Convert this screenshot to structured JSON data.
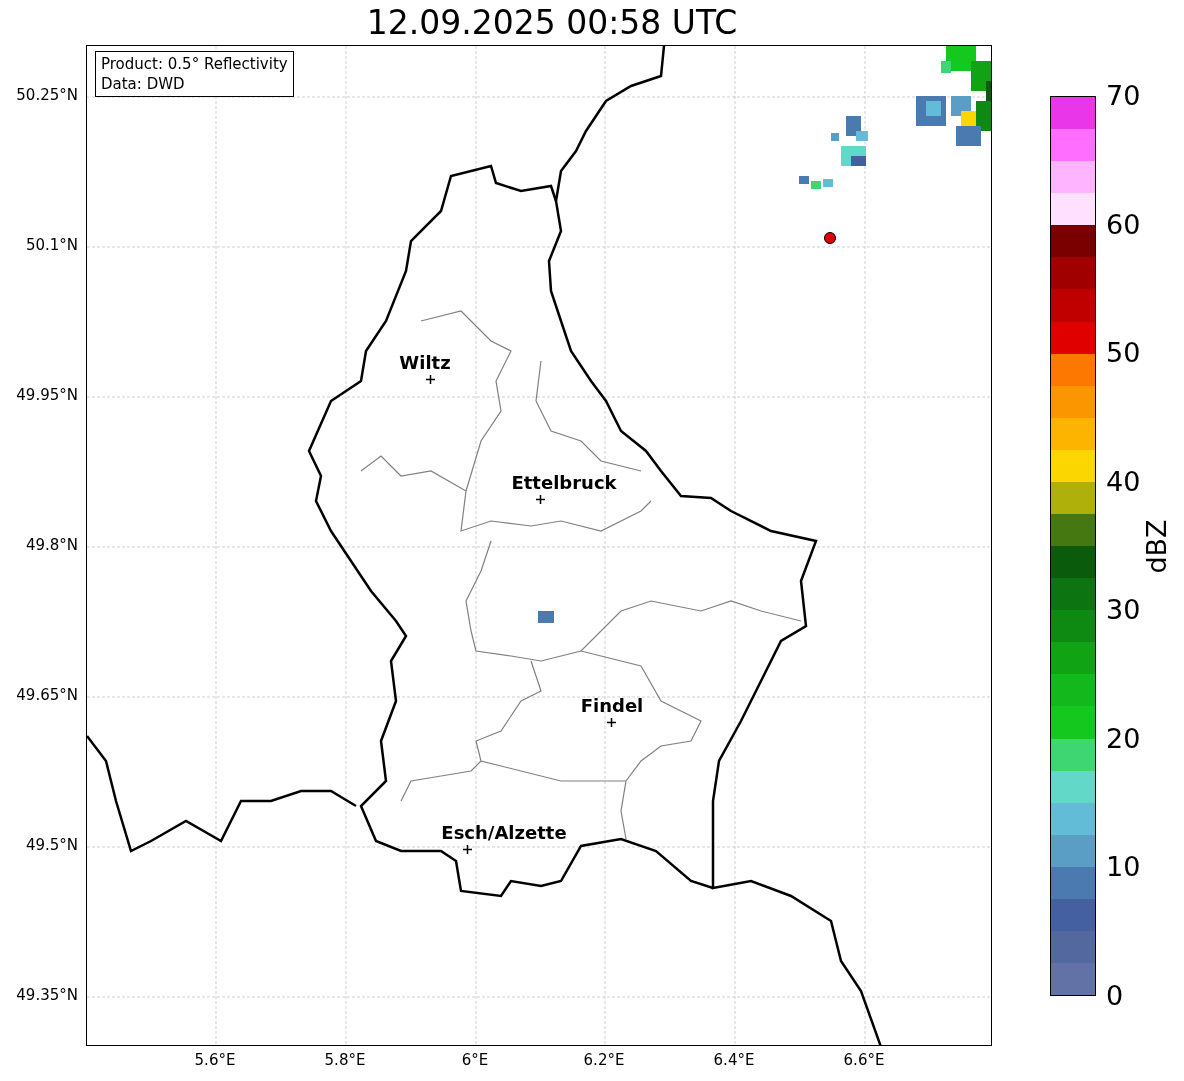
{
  "title": "12.09.2025 00:58 UTC",
  "info_box": [
    "Product: 0.5° Reflectivity",
    "Data: DWD"
  ],
  "lat_ticks": [
    "50.25°N",
    "50.1°N",
    "49.95°N",
    "49.8°N",
    "49.65°N",
    "49.5°N",
    "49.35°N"
  ],
  "lon_ticks": [
    "5.6°E",
    "5.8°E",
    "6°E",
    "6.2°E",
    "6.4°E",
    "6.6°E"
  ],
  "cities": [
    {
      "name": "Wiltz"
    },
    {
      "name": "Ettelbruck"
    },
    {
      "name": "Findel"
    },
    {
      "name": "Esch/Alzette"
    }
  ],
  "colorbar": {
    "label": "dBZ",
    "ticks": [
      "70",
      "60",
      "50",
      "40",
      "30",
      "20",
      "10",
      "0"
    ],
    "segments": [
      {
        "color": "#e836e8"
      },
      {
        "color": "#ff6eff"
      },
      {
        "color": "#ffb4ff"
      },
      {
        "color": "#ffe0ff"
      },
      {
        "color": "#7a0000"
      },
      {
        "color": "#a00000"
      },
      {
        "color": "#c00000"
      },
      {
        "color": "#e00000"
      },
      {
        "color": "#fc7800"
      },
      {
        "color": "#fc9600"
      },
      {
        "color": "#fcb400"
      },
      {
        "color": "#fcd600"
      },
      {
        "color": "#b0b00a"
      },
      {
        "color": "#467812"
      },
      {
        "color": "#0a5c0c"
      },
      {
        "color": "#0c7410"
      },
      {
        "color": "#0e8a12"
      },
      {
        "color": "#10a414"
      },
      {
        "color": "#12b81c"
      },
      {
        "color": "#14c81e"
      },
      {
        "color": "#3ed672"
      },
      {
        "color": "#62d8c8"
      },
      {
        "color": "#62bcd8"
      },
      {
        "color": "#5a9ec6"
      },
      {
        "color": "#4a7ab0"
      },
      {
        "color": "#4460a0"
      },
      {
        "color": "#52689e"
      },
      {
        "color": "#6272a6"
      }
    ]
  }
}
